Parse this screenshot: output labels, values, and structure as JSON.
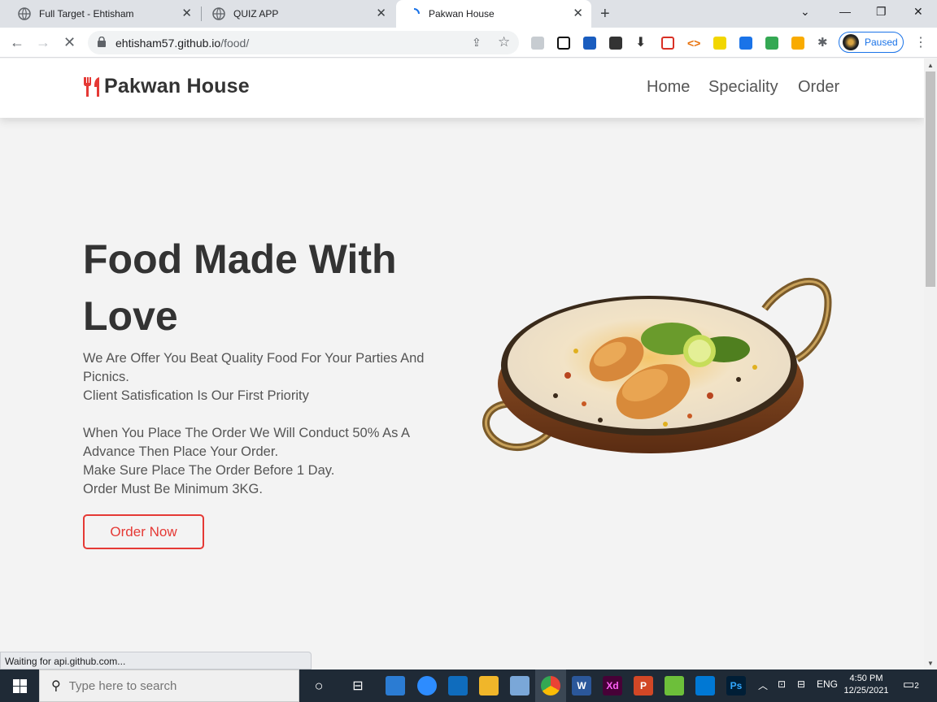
{
  "browser": {
    "tabs": [
      {
        "title": "Full Target - Ehtisham"
      },
      {
        "title": "QUIZ APP"
      },
      {
        "title": "Pakwan House"
      }
    ],
    "url_host": "ehtisham57.github.io",
    "url_path": "/food/",
    "profile_status": "Paused",
    "status_text": "Waiting for api.github.com..."
  },
  "site": {
    "brand": "Pakwan House",
    "nav": [
      "Home",
      "Speciality",
      "Order"
    ],
    "hero": {
      "title": "Food Made With Love",
      "line1": "We Are Offer You Beat Quality Food For Your Parties And Picnics.",
      "line2": "Client Satisfication Is Our First Priority",
      "line3": "When You Place The Order We Will Conduct 50% As A Advance Then Place Your Order.",
      "line4": "Make Sure Place The Order Before 1 Day.",
      "line5": "Order Must Be Minimum 3KG.",
      "cta": "Order Now"
    },
    "accent_color": "#e53935"
  },
  "taskbar": {
    "search_placeholder": "Type here to search",
    "language": "ENG",
    "time": "4:50 PM",
    "date": "12/25/2021",
    "notifications": "2"
  }
}
